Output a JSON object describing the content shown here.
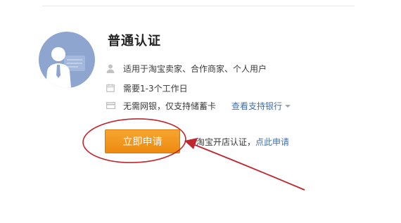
{
  "title": "普通认证",
  "features": [
    {
      "icon": "user-icon",
      "text": "适用于淘宝卖家、合作商家、个人用户"
    },
    {
      "icon": "calendar-icon",
      "text": "需要1-3个工作日"
    },
    {
      "icon": "card-icon",
      "text": "无需网银，仅支持储蓄卡"
    }
  ],
  "supported_banks_link": "查看支持银行",
  "apply_button": "立即申请",
  "store_note": {
    "text": "淘宝开店认证，",
    "link": "点此申请"
  },
  "colors": {
    "accent_orange": "#f29a1f",
    "link_blue": "#3f6fb0",
    "annotation_red": "#c0262d",
    "avatar_blue": "#8ea6cf"
  }
}
